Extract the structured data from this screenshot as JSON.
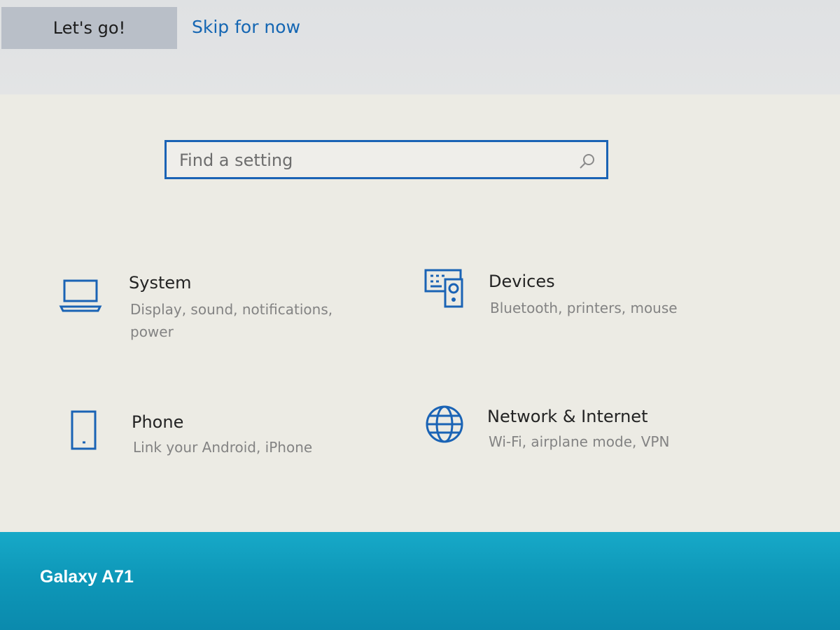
{
  "header": {
    "lets_go_label": "Let's go!",
    "skip_label": "Skip for now"
  },
  "search": {
    "placeholder": "Find a setting",
    "icon": "search-icon"
  },
  "categories": [
    {
      "title": "System",
      "desc_line1": "Display, sound, notifications,",
      "desc_line2": "power",
      "icon": "laptop-icon"
    },
    {
      "title": "Devices",
      "desc_line1": "Bluetooth, printers, mouse",
      "icon": "keyboard-speaker-icon"
    },
    {
      "title": "Phone",
      "desc_line1": "Link your Android, iPhone",
      "icon": "phone-icon"
    },
    {
      "title": "Network & Internet",
      "desc_line1": "Wi-Fi, airplane mode, VPN",
      "icon": "globe-icon"
    }
  ],
  "watermark": {
    "text": "Galaxy A71"
  },
  "colors": {
    "accent": "#1a63b5",
    "link": "#1466b3",
    "button_bg": "#b9bfc8",
    "taskbar": "#12a0c0"
  }
}
